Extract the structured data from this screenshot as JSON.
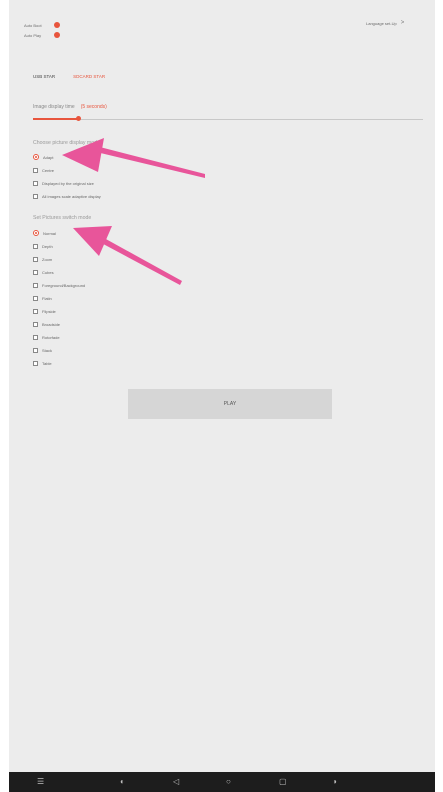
{
  "status": {
    "toggles": [
      {
        "label": "Auto Boot"
      },
      {
        "label": "Auto Play"
      }
    ],
    "language": "Language set-Up",
    "language_chevron": ">"
  },
  "source": {
    "usb": "USB STAR",
    "sd": "SDCARD STAR"
  },
  "image_time": {
    "label": "Image display time",
    "value": "(5 seconds)",
    "slider_fraction": 0.1
  },
  "display_mode": {
    "title": "Choose picture display mode",
    "options": [
      {
        "label": "Adapt",
        "selected": true
      },
      {
        "label": "Centre",
        "selected": false
      },
      {
        "label": "Displayed by the original size",
        "selected": false
      },
      {
        "label": "All images scale adaptive display",
        "selected": false
      }
    ]
  },
  "switch_mode": {
    "title": "Set Pictures switch mode",
    "options": [
      {
        "label": "Normal",
        "selected": true
      },
      {
        "label": "Depth",
        "selected": false
      },
      {
        "label": "Zoom",
        "selected": false
      },
      {
        "label": "Cubes",
        "selected": false
      },
      {
        "label": "Foreground/Background",
        "selected": false
      },
      {
        "label": "Flatin",
        "selected": false
      },
      {
        "label": "Flipside",
        "selected": false
      },
      {
        "label": "Broadside",
        "selected": false
      },
      {
        "label": "Rotorfade",
        "selected": false
      },
      {
        "label": "Stack",
        "selected": false
      },
      {
        "label": "Table",
        "selected": false
      }
    ]
  },
  "play_button": "PLAY",
  "colors": {
    "accent": "#e8553d",
    "annotation_arrow": "#e8559a",
    "background": "#ececec",
    "navbar": "#1d1d1d"
  },
  "nav_icons": [
    "recent-apps-icon",
    "volume-down-icon",
    "back-icon",
    "home-icon",
    "screenshot-icon",
    "volume-up-icon"
  ]
}
